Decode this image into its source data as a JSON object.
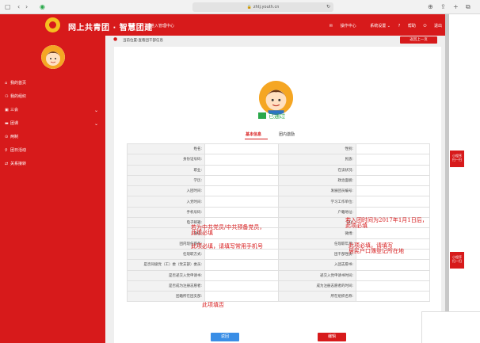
{
  "browser": {
    "url": "zhtj.youth.cn",
    "icons": [
      "sidebar-icon",
      "back-icon",
      "forward-icon",
      "shield-icon",
      "lock-icon",
      "reload-icon",
      "download-icon",
      "share-icon",
      "new-tab-icon",
      "tabs-icon"
    ]
  },
  "header": {
    "brand": "网上共青团 · 智慧团建",
    "sub": "进入管理中心",
    "menu": [
      "操作中心",
      "系统设置",
      "帮助",
      "退出"
    ],
    "bg_color": "#d71a1b"
  },
  "sidebar": {
    "items": [
      {
        "label": "我的首页",
        "icon": "home-icon",
        "expand": false
      },
      {
        "label": "我的组织",
        "icon": "group-icon",
        "expand": false
      },
      {
        "label": "三会",
        "icon": "meeting-icon",
        "expand": true
      },
      {
        "label": "团课",
        "icon": "folder-icon",
        "expand": true
      },
      {
        "label": "两制",
        "icon": "circle-icon",
        "expand": false
      },
      {
        "label": "团日活动",
        "icon": "activity-icon",
        "expand": false
      },
      {
        "label": "关系接转",
        "icon": "transfer-icon",
        "expand": false
      }
    ]
  },
  "breadcrumb": {
    "text": "当前位置:查看团干部信息",
    "back_label": "返回上一页"
  },
  "profile": {
    "status": "已通过",
    "tabs": [
      "基本信息",
      "团内激励"
    ]
  },
  "form": {
    "rows": [
      [
        "姓名:",
        "性别:"
      ],
      [
        "身份证号码:",
        "民族:"
      ],
      [
        "职业:",
        "在读状况:"
      ],
      [
        "学历:",
        "政治面貌:"
      ],
      [
        "入团时间:",
        "发展团员编号:"
      ],
      [
        "入党时间:",
        "学习工作单位:"
      ],
      [
        "手机号码:",
        "户籍地址:"
      ],
      [
        "电子邮箱:",
        "QQ:"
      ],
      [
        "微信:",
        "微博:"
      ],
      [
        "团内现任职务:",
        "任现职年月:"
      ],
      [
        "任现职方式:",
        "团干部性质:"
      ],
      [
        "是否同级党（工）委（党支部）委员:",
        "入团志愿书:"
      ],
      [
        "是否递交入党申请书:",
        "递交入党申请书时间:"
      ],
      [
        "是否成为注册志愿者:",
        "成为注册志愿者的时间:"
      ],
      [
        "团籍所在团支部:",
        "所在组织名称:"
      ]
    ]
  },
  "annotations": {
    "party": "若为中共党员/中共预备党员，\n此项必填",
    "mobile": "此项必填，请填写常用手机号",
    "join": "若入团时间为2017年1月1日后，\n此项必填",
    "hukou": "此项必填，请填写\n居民户口簿登记所在地",
    "volunteer": "此项填否"
  },
  "buttons": {
    "back": "返回",
    "edit": "编辑"
  },
  "side_float": {
    "qr1": "小程序\n扫一扫",
    "qr2": "小程序\n扫一扫"
  }
}
